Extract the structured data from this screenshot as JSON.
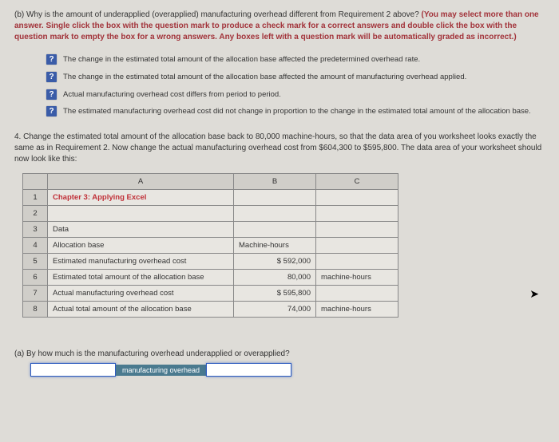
{
  "question_b": {
    "prefix": "(b) Why is the amount of underapplied (overapplied) manufacturing overhead different from Requirement 2 above? ",
    "instruction": "(You may select more than one answer. Single click the box with the question mark to produce a check mark for a correct answers and double click the box with the question mark to empty the box for a wrong answers. Any boxes left with a question mark will be automatically graded as incorrect.)"
  },
  "options": [
    "The change in the estimated total amount of the allocation base affected the predetermined overhead rate.",
    "The change in the estimated total amount of the allocation base affected the amount of manufacturing overhead applied.",
    "Actual manufacturing overhead cost differs from period to period.",
    "The estimated manufacturing overhead cost did not change in proportion to the change in the estimated total amount of the allocation base."
  ],
  "checkbox_glyph": "?",
  "question_4": "4. Change the estimated total amount of the allocation base back to 80,000 machine-hours, so that the data area of you worksheet looks exactly the same as in Requirement 2. Now change the actual manufacturing overhead cost from $604,300 to $595,800. The data area of your worksheet should now look like this:",
  "table": {
    "headers": [
      "",
      "A",
      "B",
      "C"
    ],
    "rows": [
      {
        "n": "1",
        "a": "Chapter 3: Applying Excel",
        "b": "",
        "c": ""
      },
      {
        "n": "2",
        "a": "",
        "b": "",
        "c": ""
      },
      {
        "n": "3",
        "a": "Data",
        "b": "",
        "c": ""
      },
      {
        "n": "4",
        "a": "Allocation base",
        "b": "Machine-hours",
        "c": ""
      },
      {
        "n": "5",
        "a": "Estimated manufacturing overhead cost",
        "b": "$    592,000",
        "c": ""
      },
      {
        "n": "6",
        "a": "Estimated total amount of the allocation base",
        "b": "80,000",
        "c": "machine-hours"
      },
      {
        "n": "7",
        "a": "Actual manufacturing overhead cost",
        "b": "$    595,800",
        "c": ""
      },
      {
        "n": "8",
        "a": "Actual total amount of the allocation base",
        "b": "74,000",
        "c": "machine-hours"
      }
    ]
  },
  "question_a": "(a) By how much is the manufacturing overhead underapplied or overapplied?",
  "mid_label": "manufacturing overhead"
}
